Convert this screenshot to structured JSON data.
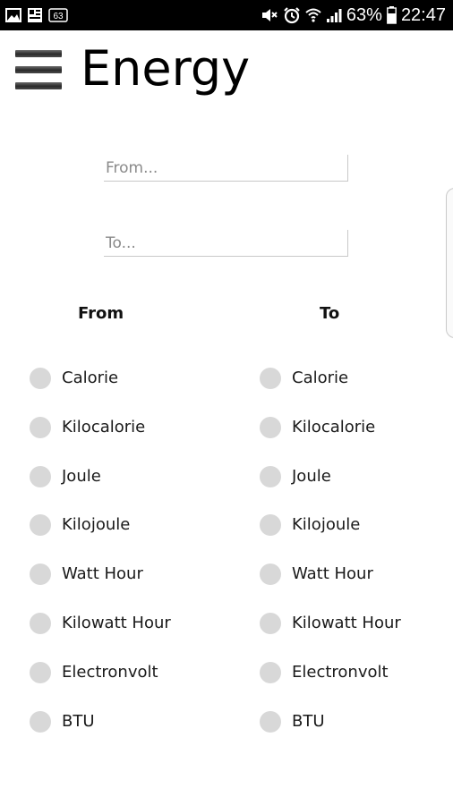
{
  "status_bar": {
    "icons_left": [
      "image-icon",
      "gallery-icon",
      "badge-63-icon"
    ],
    "badge_text": "63",
    "icons_right": [
      "mute-icon",
      "alarm-icon",
      "wifi-icon",
      "signal-icon",
      "battery-icon"
    ],
    "battery": "63%",
    "time": "22:47"
  },
  "header": {
    "title": "Energy",
    "menu_icon": "hamburger-menu-icon"
  },
  "inputs": {
    "from": {
      "value": "",
      "placeholder": "From..."
    },
    "to": {
      "value": "",
      "placeholder": "To..."
    }
  },
  "columns": {
    "from_header": "From",
    "to_header": "To"
  },
  "units": [
    {
      "label": "Calorie"
    },
    {
      "label": "Kilocalorie"
    },
    {
      "label": "Joule"
    },
    {
      "label": "Kilojoule"
    },
    {
      "label": "Watt Hour"
    },
    {
      "label": "Kilowatt Hour"
    },
    {
      "label": "Electronvolt"
    },
    {
      "label": "BTU"
    }
  ],
  "colors": {
    "status_bar_bg": "#000000",
    "background": "#ffffff",
    "radio_unselected": "#d8d8d8",
    "input_underline": "#c8c8c8"
  }
}
